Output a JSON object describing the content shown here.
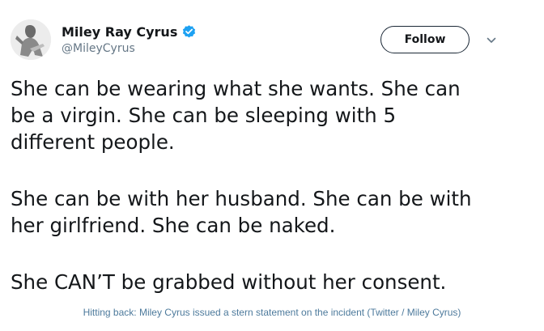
{
  "tweet": {
    "display_name": "Miley Ray Cyrus",
    "handle": "@MileyCyrus",
    "verified_icon": "verified-badge-icon",
    "follow_label": "Follow",
    "menu_icon": "chevron-down-icon",
    "lines": [
      "She can be wearing what she wants. She can",
      "be a virgin. She can be sleeping with 5",
      "different people.",
      "She can be with her husband. She can be with",
      "her girlfriend. She can be naked.",
      "She CAN’T be grabbed without her consent."
    ]
  },
  "caption": "Hitting back: Miley Cyrus issued a stern statement on the incident (Twitter / Miley Cyrus)",
  "colors": {
    "verified": "#1da1f2",
    "handle": "#657786",
    "text": "#14171a",
    "caption": "#4d7a9c"
  }
}
